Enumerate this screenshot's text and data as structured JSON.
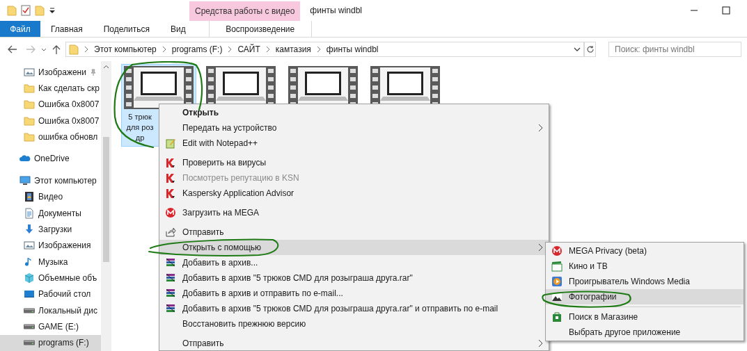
{
  "window": {
    "title": "финты windbl",
    "contextual_group": "Средства работы с видео"
  },
  "ribbon_tabs": [
    {
      "label": "Файл",
      "kind": "file",
      "selected": false
    },
    {
      "label": "Главная",
      "kind": "tab",
      "selected": false
    },
    {
      "label": "Поделиться",
      "kind": "tab",
      "selected": false
    },
    {
      "label": "Вид",
      "kind": "tab",
      "selected": false
    },
    {
      "label": "Воспроизведение",
      "kind": "contextual",
      "selected": false
    }
  ],
  "address": {
    "breadcrumbs": [
      "Этот компьютер",
      "programs (F:)",
      "САЙТ",
      "камтазия",
      "финты windbl"
    ]
  },
  "search": {
    "placeholder": "Поиск: финты windbl"
  },
  "sidebar": {
    "quick_access_items": [
      {
        "label": "Изображени",
        "kind": "pictures",
        "pinned": true,
        "selected": false
      },
      {
        "label": "Как сделать скр",
        "kind": "folder",
        "pinned": false,
        "selected": false
      },
      {
        "label": "Ошибка 0x8007",
        "kind": "folder",
        "pinned": false,
        "selected": false
      },
      {
        "label": "Ошибка 0x8007",
        "kind": "folder",
        "pinned": false,
        "selected": false
      },
      {
        "label": "ошибка обновл",
        "kind": "folder",
        "pinned": false,
        "selected": false
      }
    ],
    "items": [
      {
        "label": "OneDrive",
        "kind": "cloud",
        "selected": false
      },
      {
        "label": "Этот компьютер",
        "kind": "pc",
        "selected": false,
        "children": [
          {
            "label": "Видео",
            "kind": "video",
            "selected": false
          },
          {
            "label": "Документы",
            "kind": "docs",
            "selected": false
          },
          {
            "label": "Загрузки",
            "kind": "download",
            "selected": false
          },
          {
            "label": "Изображения",
            "kind": "pictures",
            "selected": false
          },
          {
            "label": "Музыка",
            "kind": "music",
            "selected": false
          },
          {
            "label": "Объемные объ",
            "kind": "cube",
            "selected": false
          },
          {
            "label": "Рабочий стол",
            "kind": "desktop",
            "selected": false
          },
          {
            "label": "Локальный дис",
            "kind": "drive",
            "selected": false
          },
          {
            "label": "GAME (E:)",
            "kind": "drive",
            "selected": false
          },
          {
            "label": "programs (F:)",
            "kind": "drive",
            "selected": true
          }
        ]
      }
    ]
  },
  "files": [
    {
      "lines": [
        "5 трюк",
        "для роз",
        "др"
      ],
      "selected": true
    },
    {
      "selected": false
    },
    {
      "selected": false
    },
    {
      "selected": false
    }
  ],
  "context_menu": [
    {
      "kind": "plain",
      "label": "Открыть",
      "bold": true,
      "disabled": false,
      "submenu": false,
      "selected": false
    },
    {
      "kind": "plain",
      "label": "Передать на устройство",
      "bold": false,
      "disabled": false,
      "submenu": true,
      "selected": false
    },
    {
      "kind": "notepad",
      "label": "Edit with Notepad++",
      "bold": false,
      "disabled": false,
      "submenu": false,
      "selected": false
    },
    {
      "kind": "separator"
    },
    {
      "kind": "kaspersky",
      "label": "Проверить на вирусы",
      "bold": false,
      "disabled": false,
      "submenu": false,
      "selected": false
    },
    {
      "kind": "kaspersky",
      "label": "Посмотреть репутацию в KSN",
      "bold": false,
      "disabled": true,
      "submenu": false,
      "selected": false
    },
    {
      "kind": "kaspersky",
      "label": "Kaspersky Application Advisor",
      "bold": false,
      "disabled": false,
      "submenu": false,
      "selected": false
    },
    {
      "kind": "separator"
    },
    {
      "kind": "mega",
      "label": "Загрузить на MEGA",
      "bold": false,
      "disabled": false,
      "submenu": false,
      "selected": false
    },
    {
      "kind": "separator"
    },
    {
      "kind": "share",
      "label": "Отправить",
      "bold": false,
      "disabled": false,
      "submenu": false,
      "selected": false
    },
    {
      "kind": "plain",
      "label": "Открыть с помощью",
      "bold": false,
      "disabled": false,
      "submenu": true,
      "selected": true
    },
    {
      "kind": "winrar",
      "label": "Добавить в архив...",
      "bold": false,
      "disabled": false,
      "submenu": false,
      "selected": false
    },
    {
      "kind": "winrar",
      "label": "Добавить в архив \"5 трюков CMD для розыграша друга.rar\"",
      "bold": false,
      "disabled": false,
      "submenu": false,
      "selected": false
    },
    {
      "kind": "winrar",
      "label": "Добавить в архив и отправить по e-mail...",
      "bold": false,
      "disabled": false,
      "submenu": false,
      "selected": false
    },
    {
      "kind": "winrar",
      "label": "Добавить в архив \"5 трюков CMD для розыграша друга.rar\" и отправить по e-mail",
      "bold": false,
      "disabled": false,
      "submenu": false,
      "selected": false
    },
    {
      "kind": "plain",
      "label": "Восстановить прежнюю версию",
      "bold": false,
      "disabled": false,
      "submenu": false,
      "selected": false
    },
    {
      "kind": "separator"
    },
    {
      "kind": "plain",
      "label": "Отправить",
      "bold": false,
      "disabled": false,
      "submenu": true,
      "selected": false
    }
  ],
  "submenu": [
    {
      "kind": "mega",
      "label": "MEGA Privacy (beta)",
      "selected": false
    },
    {
      "kind": "film",
      "label": "Кино и ТВ",
      "selected": false
    },
    {
      "kind": "wmp",
      "label": "Проигрыватель Windows Media",
      "selected": false
    },
    {
      "kind": "photos",
      "label": "Фотографии",
      "selected": true
    },
    {
      "kind": "separator"
    },
    {
      "kind": "store",
      "label": "Поиск в Магазине",
      "selected": false
    },
    {
      "kind": "plain",
      "label": "Выбрать другое приложение",
      "selected": false
    }
  ]
}
